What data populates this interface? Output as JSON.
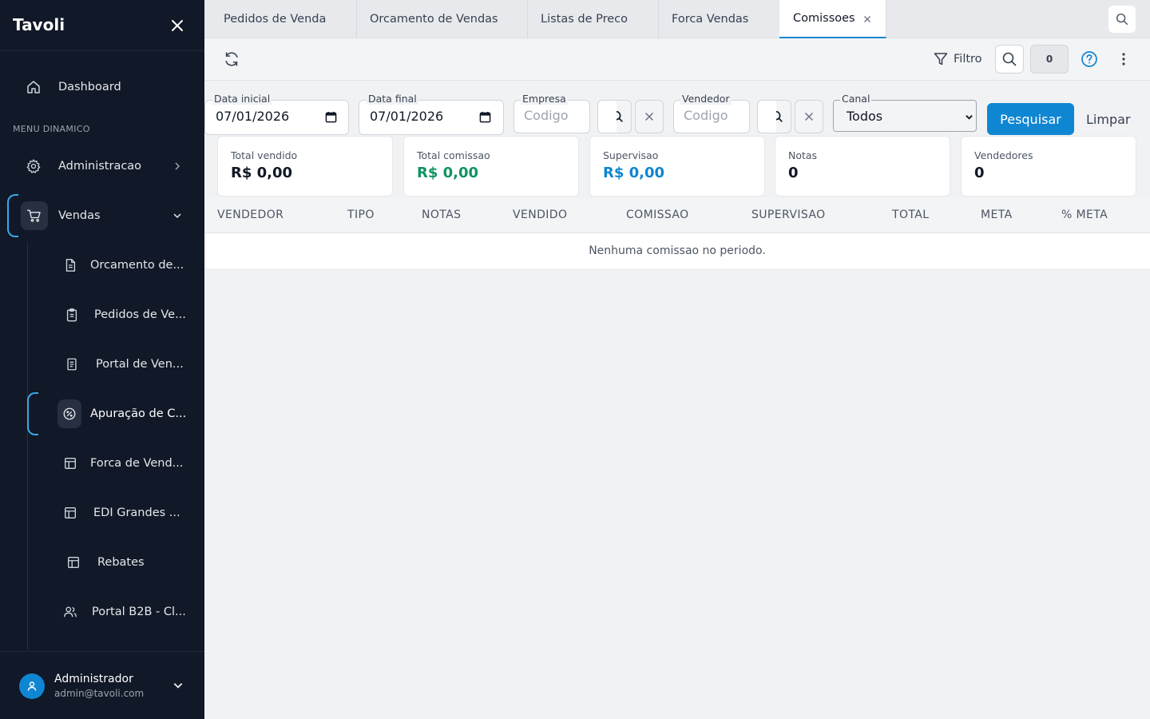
{
  "app": {
    "name": "Tavoli"
  },
  "sidebar": {
    "dashboard": "Dashboard",
    "section_title": "MENU DINAMICO",
    "administracao": "Administracao",
    "vendas": "Vendas",
    "sub_items": [
      {
        "label": "Orcamento de...",
        "icon": "file-text-icon"
      },
      {
        "label": "Pedidos de Ve...",
        "icon": "clipboard-icon"
      },
      {
        "label": "Portal de Ven...",
        "icon": "document-icon"
      },
      {
        "label": "Apuração de C...",
        "icon": "percent-badge-icon"
      },
      {
        "label": "Forca de Vend...",
        "icon": "layout-icon"
      },
      {
        "label": "EDI Grandes ...",
        "icon": "layout-icon"
      },
      {
        "label": "Rebates",
        "icon": "layout-icon"
      },
      {
        "label": "Portal B2B - Cl...",
        "icon": "users-icon"
      }
    ]
  },
  "user": {
    "name": "Administrador",
    "email": "admin@tavoli.com"
  },
  "tabs": [
    {
      "label": "Pedidos de Venda"
    },
    {
      "label": "Orcamento de Vendas"
    },
    {
      "label": "Listas de Preco"
    },
    {
      "label": "Forca Vendas"
    },
    {
      "label": "Comissoes",
      "active": true
    }
  ],
  "toolbar": {
    "filtro": "Filtro",
    "count": "0"
  },
  "filters": {
    "data_inicial": {
      "label": "Data inicial",
      "value": "07/01/2026"
    },
    "data_final": {
      "label": "Data final",
      "value": "07/01/2026"
    },
    "empresa": {
      "label": "Empresa",
      "placeholder": "Codigo"
    },
    "vendedor": {
      "label": "Vendedor",
      "placeholder": "Codigo"
    },
    "canal": {
      "label": "Canal",
      "value": "Todos"
    },
    "pesquisar": "Pesquisar",
    "limpar": "Limpar"
  },
  "cards": [
    {
      "label": "Total vendido",
      "value": "R$ 0,00",
      "color": "#111827"
    },
    {
      "label": "Total comissao",
      "value": "R$ 0,00",
      "color": "#0f9460"
    },
    {
      "label": "Supervisao",
      "value": "R$ 0,00",
      "color": "#0f86d1"
    },
    {
      "label": "Notas",
      "value": "0",
      "color": "#111827"
    },
    {
      "label": "Vendedores",
      "value": "0",
      "color": "#111827"
    }
  ],
  "table": {
    "columns": [
      "VENDEDOR",
      "TIPO",
      "NOTAS",
      "VENDIDO",
      "COMISSAO",
      "SUPERVISAO",
      "TOTAL",
      "META",
      "% META"
    ],
    "empty_message": "Nenhuma comissao no periodo."
  },
  "colors": {
    "sidebar_bg": "#111827",
    "accent": "#0f86d1",
    "active_bracket": "#38a9e8"
  }
}
